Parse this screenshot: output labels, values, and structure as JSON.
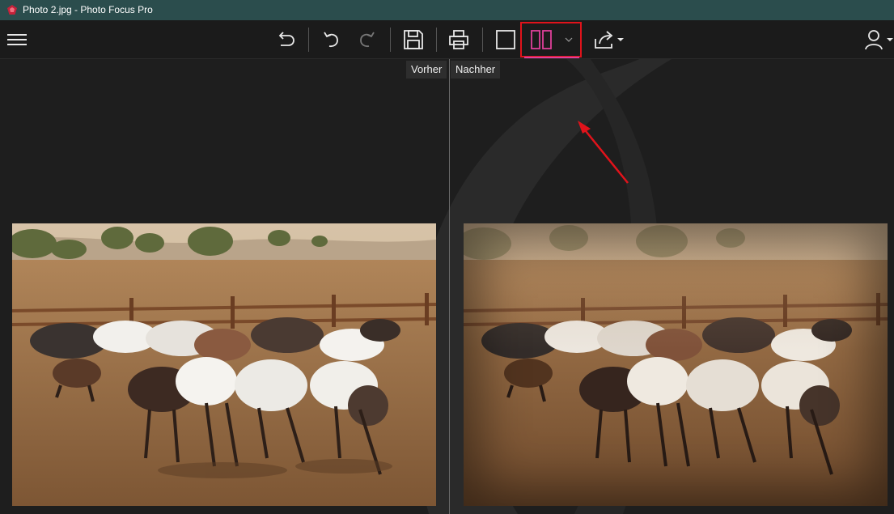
{
  "window": {
    "title": "Photo 2.jpg - Photo Focus Pro",
    "app_icon": "app-logo-icon"
  },
  "toolbar": {
    "menu_icon": "hamburger-menu-icon",
    "undo_all_icon": "undo-all-icon",
    "undo_icon": "undo-icon",
    "redo_icon": "redo-icon",
    "save_icon": "save-icon",
    "print_icon": "print-icon",
    "single_view_icon": "single-view-icon",
    "compare_view_icon": "split-view-icon",
    "compare_dropdown_icon": "chevron-down-icon",
    "share_icon": "share-icon",
    "account_icon": "user-icon"
  },
  "compare": {
    "before_label": "Vorher",
    "after_label": "Nachher"
  },
  "colors": {
    "titlebar": "#2b4d4d",
    "toolbar": "#1b1b1b",
    "canvas": "#1e1e1e",
    "highlight": "#e0131b",
    "accent": "#e0409a"
  }
}
